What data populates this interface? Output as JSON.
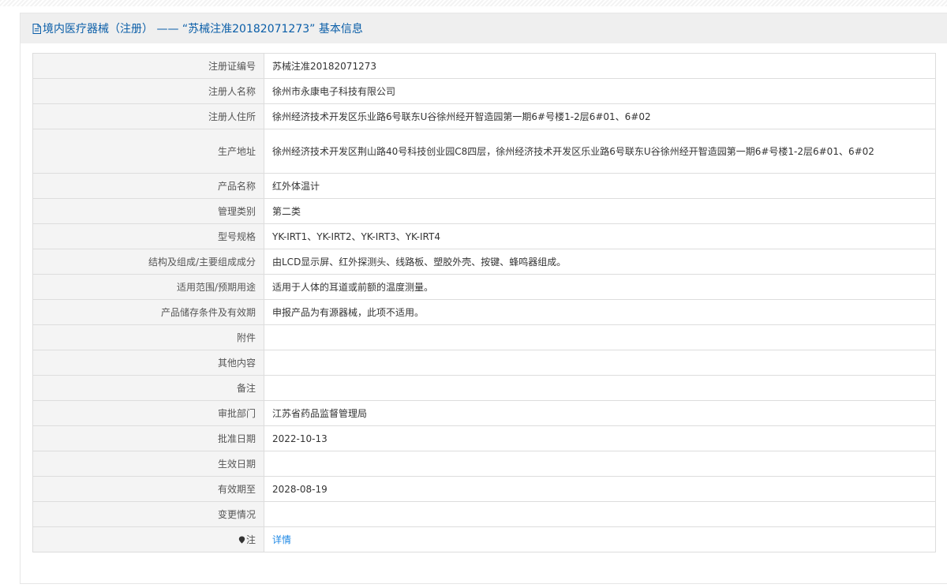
{
  "header": {
    "title": "境内医疗器械（注册） —— “苏械注准20182071273” 基本信息",
    "icon": "document-icon"
  },
  "rows": [
    {
      "label": "注册证编号",
      "value": "苏械注准20182071273"
    },
    {
      "label": "注册人名称",
      "value": "徐州市永康电子科技有限公司"
    },
    {
      "label": "注册人住所",
      "value": "徐州经济技术开发区乐业路6号联东U谷徐州经开智造园第一期6#号楼1-2层6#01、6#02"
    },
    {
      "label": "生产地址",
      "value": "徐州经济技术开发区荆山路40号科技创业园C8四层，徐州经济技术开发区乐业路6号联东U谷徐州经开智造园第一期6#号楼1-2层6#01、6#02"
    },
    {
      "label": "产品名称",
      "value": "红外体温计"
    },
    {
      "label": "管理类别",
      "value": "第二类"
    },
    {
      "label": "型号规格",
      "value": "YK-IRT1、YK-IRT2、YK-IRT3、YK-IRT4"
    },
    {
      "label": "结构及组成/主要组成成分",
      "value": "由LCD显示屏、红外探测头、线路板、塑胶外壳、按键、蜂鸣器组成。"
    },
    {
      "label": "适用范围/预期用途",
      "value": "适用于人体的耳道或前额的温度测量。"
    },
    {
      "label": "产品储存条件及有效期",
      "value": "申报产品为有源器械，此项不适用。"
    },
    {
      "label": "附件",
      "value": ""
    },
    {
      "label": "其他内容",
      "value": ""
    },
    {
      "label": "备注",
      "value": ""
    },
    {
      "label": "审批部门",
      "value": "江苏省药品监督管理局"
    },
    {
      "label": "批准日期",
      "value": "2022-10-13"
    },
    {
      "label": "生效日期",
      "value": ""
    },
    {
      "label": "有效期至",
      "value": "2028-08-19"
    },
    {
      "label": "变更情况",
      "value": ""
    }
  ],
  "note": {
    "label": "注",
    "icon": "map-pin-icon",
    "link_text": "详情"
  },
  "colors": {
    "header_text": "#0a5ea8",
    "link": "#1e88e5",
    "label_bg": "#f4f4f4",
    "border": "#dddddd"
  }
}
